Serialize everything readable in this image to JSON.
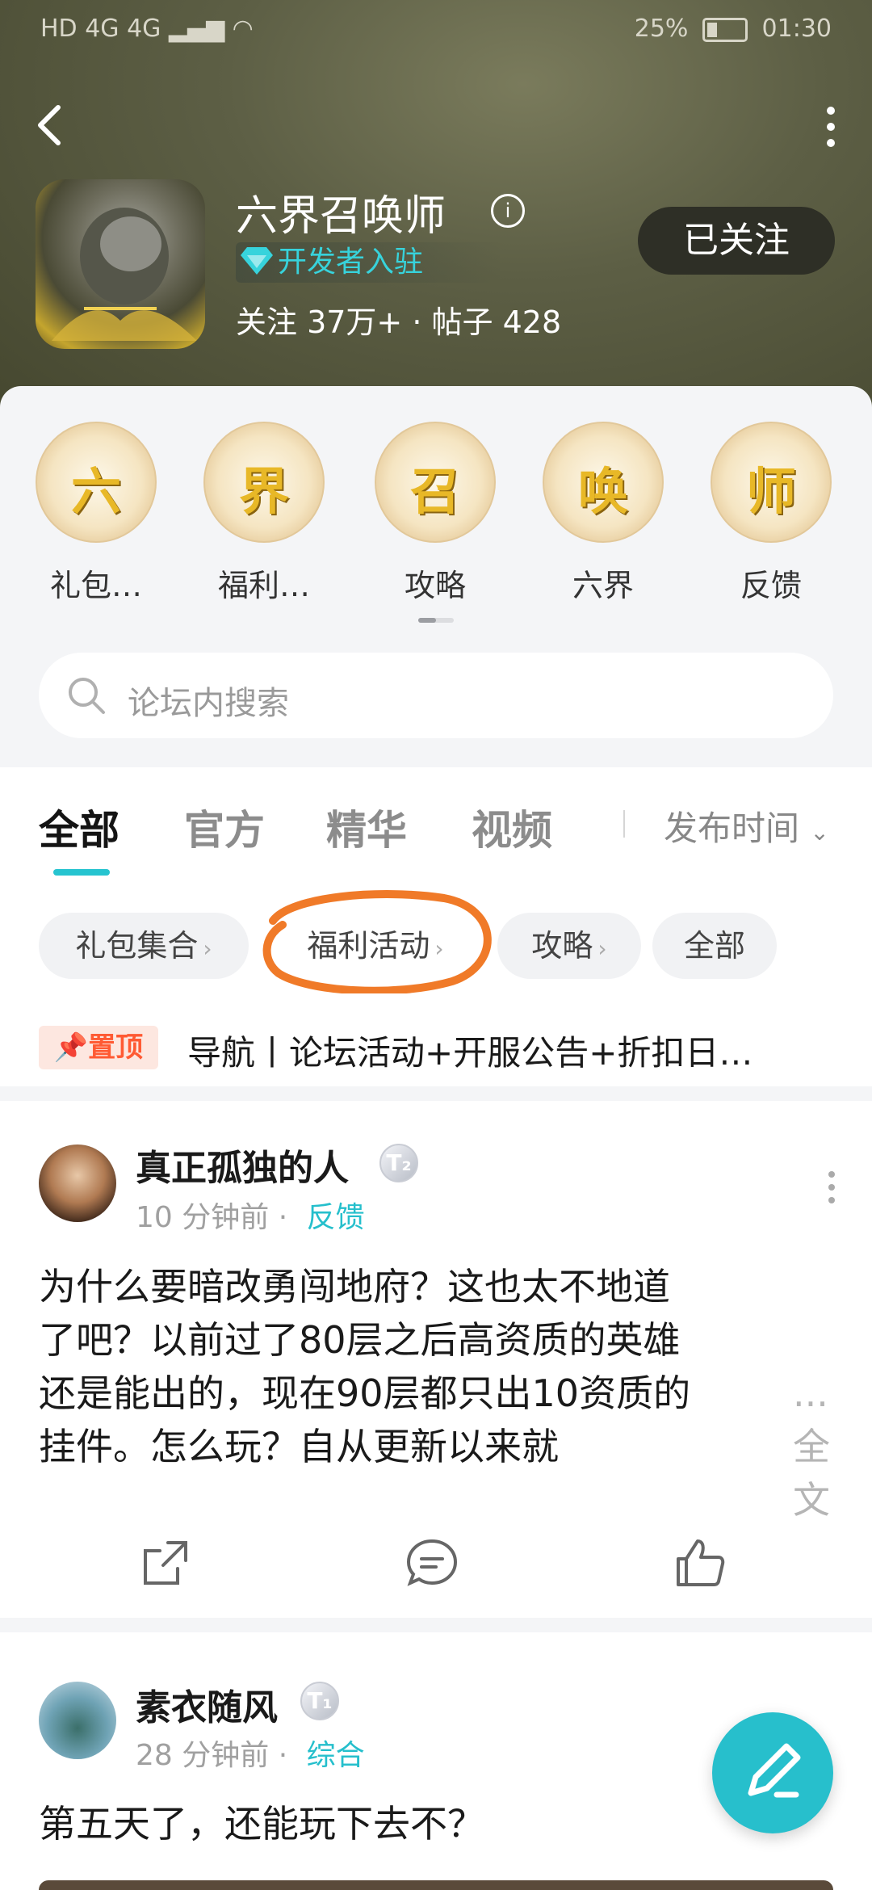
{
  "status_bar": {
    "left": "HD 4G 4G ▂▄▆ ◠",
    "battery": "25%",
    "time": "01:30"
  },
  "forum": {
    "title": "六界召唤师",
    "dev_badge": "开发者入驻",
    "stats": "关注 37万+ · 帖子 428",
    "follow_label": "已关注"
  },
  "categories": [
    {
      "emblem": "六",
      "label": "礼包…"
    },
    {
      "emblem": "界",
      "label": "福利…"
    },
    {
      "emblem": "召",
      "label": "攻略"
    },
    {
      "emblem": "唤",
      "label": "六界"
    },
    {
      "emblem": "师",
      "label": "反馈"
    }
  ],
  "search": {
    "placeholder": "论坛内搜索"
  },
  "tabs": [
    "全部",
    "官方",
    "精华",
    "视频"
  ],
  "sort_label": "发布时间",
  "chips": [
    "礼包集合",
    "福利活动",
    "攻略",
    "全部"
  ],
  "pinned": {
    "badge": "置顶",
    "text": "导航丨论坛活动+开服公告+折扣日…"
  },
  "posts": [
    {
      "user": "真正孤独的人",
      "level": "T₂",
      "time": "10 分钟前",
      "tag": "反馈",
      "lines": [
        "为什么要暗改勇闯地府？这也太不地道",
        "了吧？以前过了80层之后高资质的英雄",
        "还是能出的，现在90层都只出10资质的",
        "挂件。怎么玩？自从更新以来就"
      ],
      "more": "... 全文"
    },
    {
      "user": "素衣随风",
      "level": "T₁",
      "time": "28 分钟前",
      "tag": "综合",
      "lines": [
        "第五天了，还能玩下去不？"
      ]
    }
  ],
  "colors": {
    "accent": "#26c4d0",
    "pin": "#ff5a33",
    "annotation": "#f07a28"
  }
}
